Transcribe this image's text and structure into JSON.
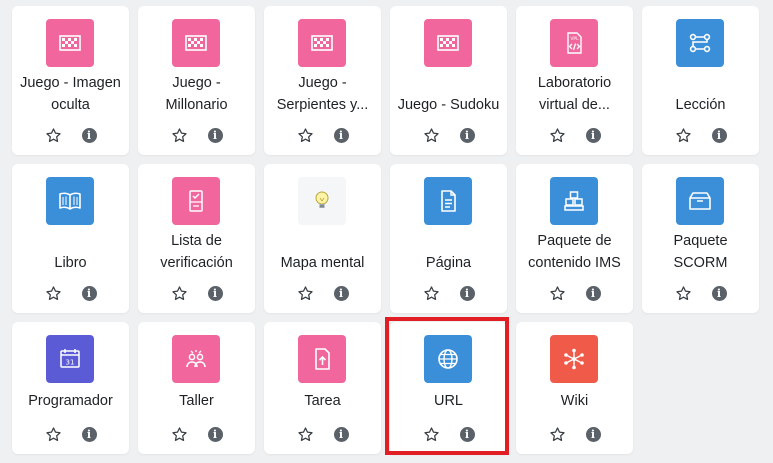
{
  "colors": {
    "pink": "#f0669d",
    "blue": "#3b8fd9",
    "purple": "#5b5bd6",
    "orange": "#f05a49",
    "highlight": "#e21e25"
  },
  "activities": [
    {
      "line1": "Juego - Imagen",
      "line2": "oculta",
      "icon": "puzzle-icon"
    },
    {
      "line1": "Juego -",
      "line2": "Millonario",
      "icon": "puzzle-icon"
    },
    {
      "line1": "Juego -",
      "line2": "Serpientes y...",
      "icon": "puzzle-icon"
    },
    {
      "line1": "Juego - Sudoku",
      "line2": "",
      "icon": "puzzle-icon"
    },
    {
      "line1": "Laboratorio",
      "line2": "virtual de...",
      "icon": "vpl-code-icon"
    },
    {
      "line1": "Lección",
      "line2": "",
      "icon": "flow-lesson-icon"
    },
    {
      "line1": "Libro",
      "line2": "",
      "icon": "book-icon"
    },
    {
      "line1": "Lista de",
      "line2": "verificación",
      "icon": "checklist-icon"
    },
    {
      "line1": "Mapa mental",
      "line2": "",
      "icon": "lightbulb-icon"
    },
    {
      "line1": "Página",
      "line2": "",
      "icon": "page-icon"
    },
    {
      "line1": "Paquete de",
      "line2": "contenido IMS",
      "icon": "package-blocks-icon"
    },
    {
      "line1": "Paquete",
      "line2": "SCORM",
      "icon": "box-icon"
    },
    {
      "line1": "Programador",
      "line2": "",
      "icon": "calendar-icon"
    },
    {
      "line1": "Taller",
      "line2": "",
      "icon": "workshop-icon"
    },
    {
      "line1": "Tarea",
      "line2": "",
      "icon": "upload-file-icon"
    },
    {
      "line1": "URL",
      "line2": "",
      "icon": "globe-icon"
    },
    {
      "line1": "Wiki",
      "line2": "",
      "icon": "network-icon"
    }
  ],
  "info_glyph": "i"
}
